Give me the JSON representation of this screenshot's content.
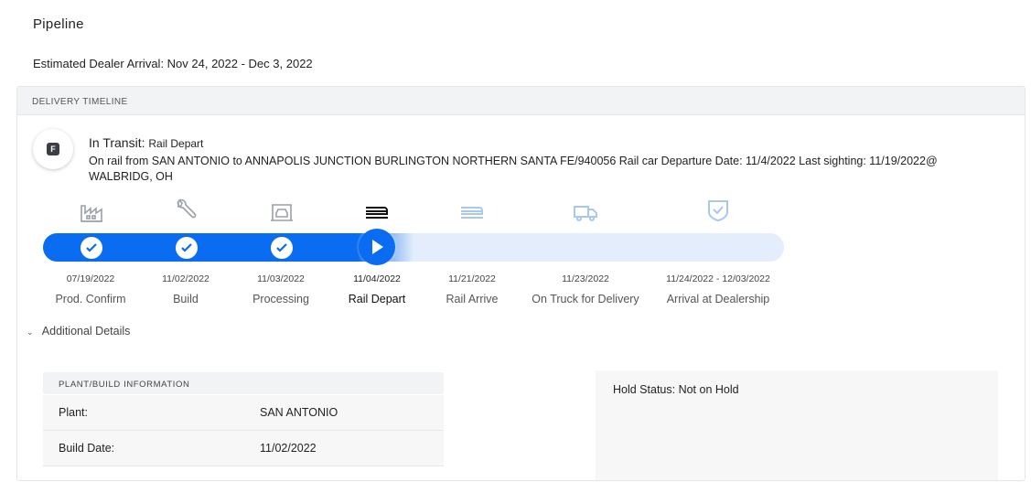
{
  "page": {
    "title": "Pipeline",
    "arrival": "Estimated Dealer Arrival: Nov 24, 2022 - Dec 3, 2022"
  },
  "timeline": {
    "header": "DELIVERY TIMELINE",
    "avatar_letter": "F",
    "status_main": "In Transit:",
    "status_sub": "Rail Depart",
    "description": "On rail from SAN ANTONIO to ANNAPOLIS JUNCTION BURLINGTON NORTHERN SANTA FE/940056 Rail car Departure Date: 11/4/2022 Last sighting: 11/19/2022@ WALBRIDG, OH",
    "progress_fraction": 0.5,
    "stages": [
      {
        "date": "07/19/2022",
        "label": "Prod. Confirm",
        "state": "done",
        "icon": "factory-icon"
      },
      {
        "date": "11/02/2022",
        "label": "Build",
        "state": "done",
        "icon": "wrench-icon"
      },
      {
        "date": "11/03/2022",
        "label": "Processing",
        "state": "done",
        "icon": "car-processing-icon"
      },
      {
        "date": "11/04/2022",
        "label": "Rail Depart",
        "state": "current",
        "icon": "rail-car-icon"
      },
      {
        "date": "11/21/2022",
        "label": "Rail Arrive",
        "state": "pending",
        "icon": "rail-car-icon"
      },
      {
        "date": "11/23/2022",
        "label": "On Truck for Delivery",
        "state": "pending",
        "icon": "truck-icon"
      },
      {
        "date": "11/24/2022 - 12/03/2022",
        "label": "Arrival at Dealership",
        "state": "pending",
        "icon": "shield-check-icon"
      }
    ]
  },
  "additional_details": {
    "label": "Additional Details",
    "plant_info": {
      "header": "PLANT/BUILD INFORMATION",
      "rows": [
        {
          "key": "Plant:",
          "value": "SAN ANTONIO"
        },
        {
          "key": "Build Date:",
          "value": "11/02/2022"
        }
      ]
    },
    "hold_status": "Hold Status: Not on Hold"
  },
  "colors": {
    "accent": "#0a6cf0",
    "track": "#e3edfb",
    "done_icon": "#9aa0a6",
    "pending_icon": "#a8c8ef"
  }
}
